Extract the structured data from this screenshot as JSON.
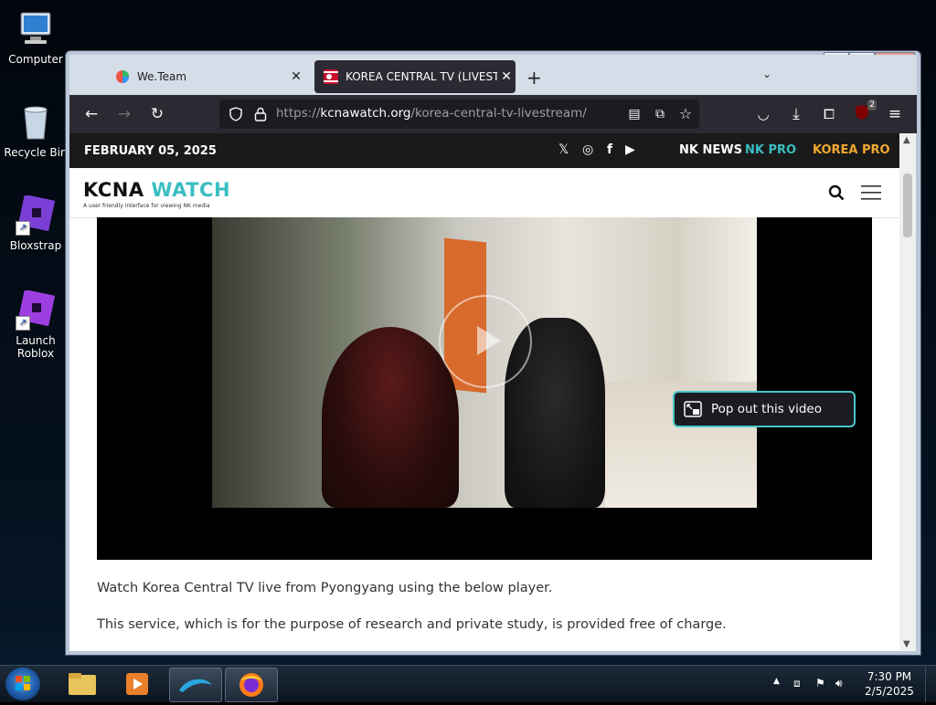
{
  "desktop": {
    "icons": [
      {
        "label": "Computer"
      },
      {
        "label": "Recycle Bin"
      },
      {
        "label": "Bloxstrap"
      },
      {
        "label": "Launch\nRoblox"
      }
    ]
  },
  "browser": {
    "tabs": [
      {
        "label": "We.Team",
        "active": false
      },
      {
        "label": "KOREA CENTRAL TV (LIVESTREAM)",
        "active": true
      }
    ],
    "url_prefix": "https://",
    "url_host": "kcnawatch.org",
    "url_path": "/korea-central-tv-livestream/",
    "extension_badge": "2"
  },
  "site": {
    "date": "FEBRUARY 05, 2025",
    "brands": [
      "NK NEWS",
      "NK PRO",
      "KOREA PRO"
    ],
    "logo_part1": "KCNA",
    "logo_part2": "WATCH",
    "tagline": "A user friendly interface for viewing NK media",
    "popout_label": "Pop out this video",
    "paragraph1": "Watch Korea Central TV live from Pyongyang using the below player.",
    "paragraph2": "This service, which is for the purpose of research and private study, is provided free of charge."
  },
  "taskbar": {
    "time": "7:30 PM",
    "date": "2/5/2025"
  },
  "colors": {
    "accent_teal": "#3bbfc2",
    "korea_pro_orange": "#f0a830",
    "nk_pro_teal": "#3bbfc2",
    "toolbar_dark": "#2b2a33"
  }
}
